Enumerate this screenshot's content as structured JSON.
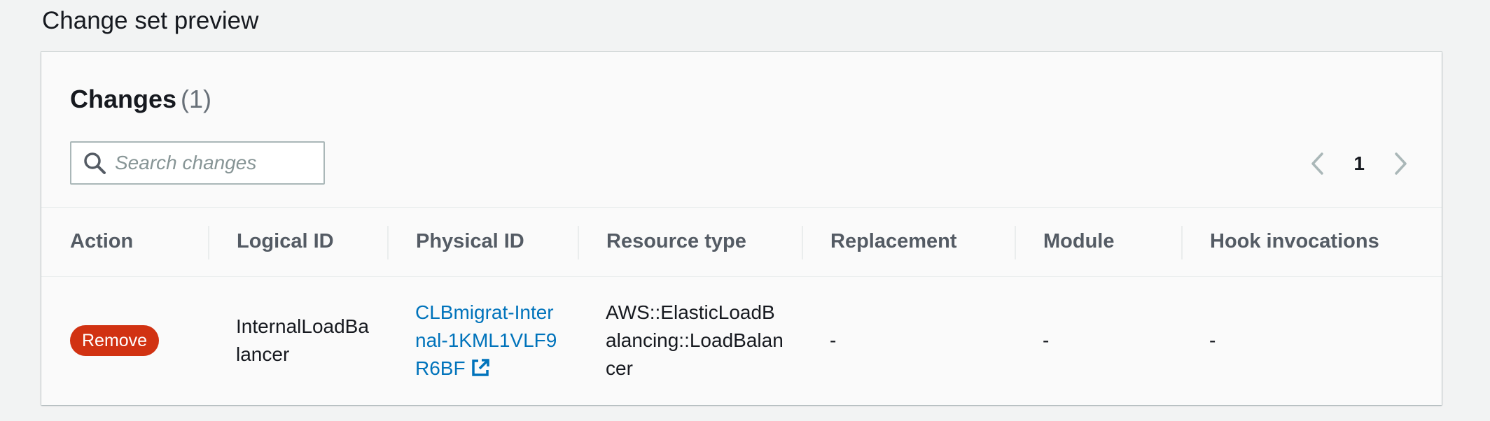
{
  "section": {
    "title": "Change set preview"
  },
  "changes": {
    "title": "Changes",
    "count": "(1)",
    "search": {
      "placeholder": "Search changes",
      "value": ""
    },
    "pagination": {
      "current_page": "1"
    },
    "columns": [
      "Action",
      "Logical ID",
      "Physical ID",
      "Resource type",
      "Replacement",
      "Module",
      "Hook invocations"
    ],
    "rows": [
      {
        "action": "Remove",
        "logical_id": "InternalLoadBalancer",
        "physical_id": "CLBmigrat-Internal-1KML1VLF9R6BF",
        "resource_type": "AWS::ElasticLoadBalancing::LoadBalancer",
        "replacement": "-",
        "module": "-",
        "hook_invocations": "-"
      }
    ]
  },
  "colors": {
    "remove_badge": "#d13212",
    "link": "#0073bb"
  },
  "icons": {
    "search": "search-icon",
    "prev": "chevron-left-icon",
    "next": "chevron-right-icon",
    "external": "external-link-icon"
  }
}
